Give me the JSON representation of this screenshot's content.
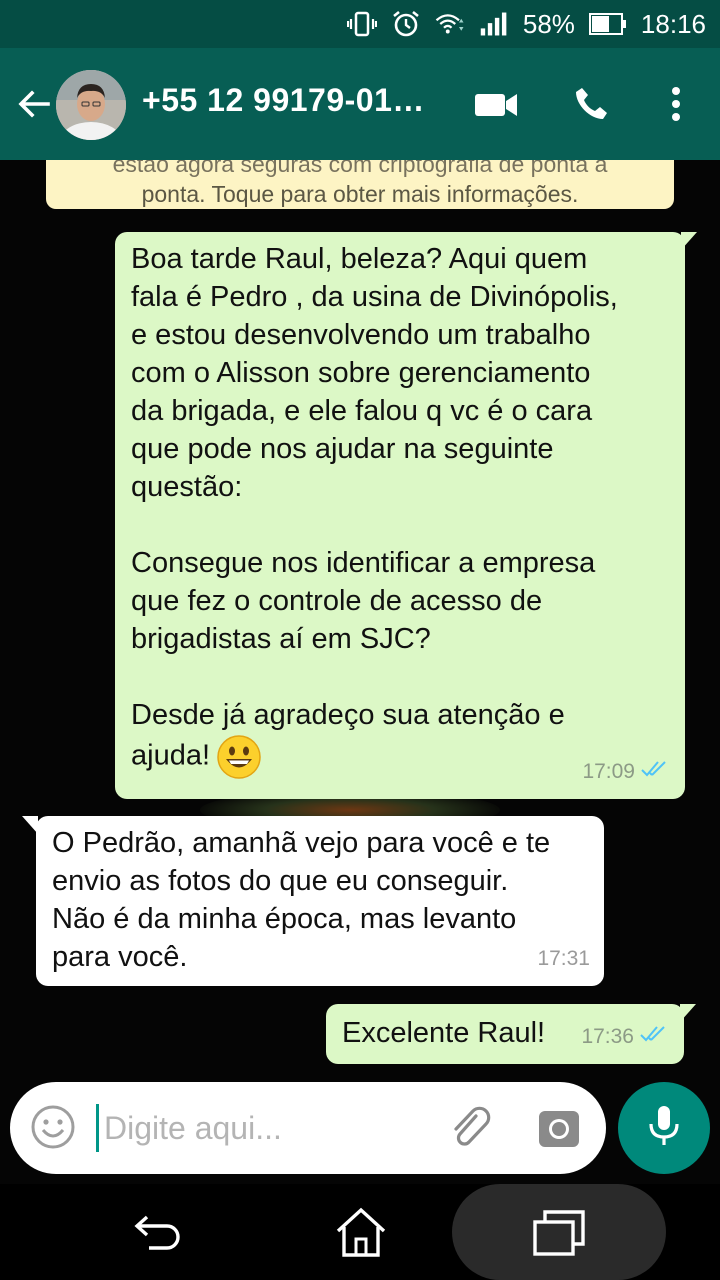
{
  "status_bar": {
    "battery": "58%",
    "time": "18:16"
  },
  "header": {
    "contact_name": "+55 12 99179-01…"
  },
  "encryption_notice": {
    "line1": "estão agora seguras com criptografia de ponta a",
    "line2": "ponta. Toque para obter mais informações."
  },
  "messages": [
    {
      "direction": "outgoing",
      "text": "Boa tarde Raul, beleza? Aqui quem\nfala é Pedro , da usina de Divinópolis,\ne estou desenvolvendo um trabalho\ncom o Alisson sobre gerenciamento\nda brigada, e ele falou q vc é o cara\nque pode nos ajudar na seguinte\nquestão:\n\nConsegue nos identificar a empresa\nque fez o controle de acesso de\nbrigadistas aí em SJC?\n\nDesde já agradeço sua atenção e\najuda!",
      "emoji": "😃",
      "time": "17:09",
      "status": "read"
    },
    {
      "direction": "incoming",
      "text": "O Pedrão, amanhã vejo para você e te\nenvio as fotos do que eu conseguir.\nNão é da minha época, mas levanto\npara você.",
      "time": "17:31"
    },
    {
      "direction": "outgoing",
      "text": "Excelente Raul!",
      "time": "17:36",
      "status": "read"
    }
  ],
  "composer": {
    "placeholder": "Digite aqui..."
  },
  "colors": {
    "header": "#075e54",
    "status_bar": "#054d44",
    "outgoing_bubble": "#dcf8c6",
    "incoming_bubble": "#ffffff",
    "accent": "#00897b",
    "read_ticks": "#4fc3f7"
  },
  "icons": [
    "back-arrow-icon",
    "video-call-icon",
    "phone-icon",
    "more-options-icon",
    "emoji-icon",
    "attach-icon",
    "camera-icon",
    "mic-icon",
    "nav-back-icon",
    "nav-home-icon",
    "nav-recents-icon"
  ]
}
